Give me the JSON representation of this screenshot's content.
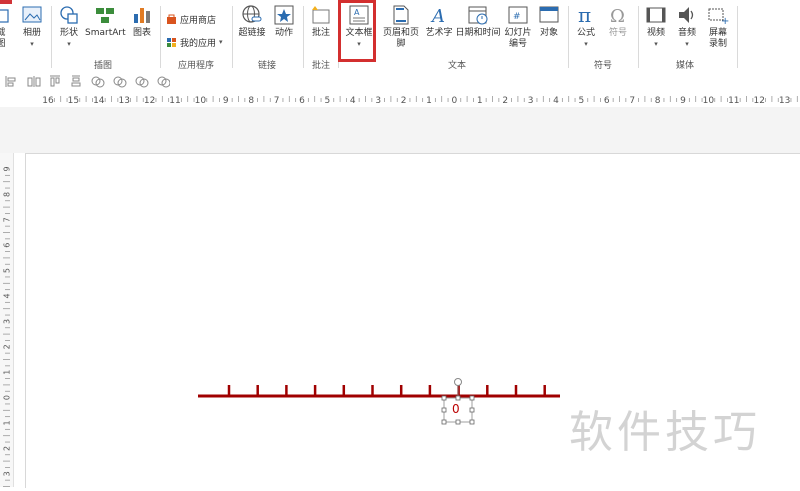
{
  "ribbon": {
    "partial_left_label": "截图",
    "buttons": {
      "album": "相册",
      "shapes": "形状",
      "smartart": "SmartArt",
      "chart": "图表",
      "app_store": "应用商店",
      "my_apps": "我的应用",
      "hyperlink": "超链接",
      "action": "动作",
      "comment": "批注",
      "textbox": "文本框",
      "header_footer": "页眉和页脚",
      "wordart": "艺术字",
      "date_time": "日期和时间",
      "slide_number_line1": "幻灯片",
      "slide_number_line2": "编号",
      "object": "对象",
      "equation": "公式",
      "symbol": "符号",
      "video": "视频",
      "audio": "音频",
      "screen_rec_line1": "屏幕",
      "screen_rec_line2": "录制"
    },
    "groups": {
      "illustrations": "插图",
      "apps": "应用程序",
      "links": "链接",
      "comments": "批注",
      "text": "文本",
      "symbols": "符号",
      "media": "媒体"
    }
  },
  "ruler": {
    "horizontal_labels": [
      "16",
      "15",
      "14",
      "13",
      "12",
      "11",
      "10",
      "9",
      "8",
      "7",
      "6",
      "5",
      "4",
      "3",
      "2",
      "1",
      "0",
      "1",
      "2",
      "3",
      "4",
      "5",
      "6",
      "7",
      "8",
      "9",
      "10",
      "11",
      "12",
      "13",
      "14"
    ],
    "vertical_labels": [
      "9",
      "8",
      "7",
      "6",
      "5",
      "4",
      "3",
      "2",
      "1",
      "0",
      "1",
      "2",
      "3"
    ]
  },
  "slide": {
    "textbox_value": "0",
    "watermark": "软件技巧"
  },
  "colors": {
    "highlight": "#d32f2f",
    "number_line": "#a00000",
    "accent_blue": "#2b6cb0"
  },
  "icons": [
    "album-icon",
    "shapes-icon",
    "smartart-icon",
    "chart-icon",
    "store-icon",
    "my-apps-icon",
    "hyperlink-icon",
    "action-icon",
    "comment-icon",
    "textbox-icon",
    "header-footer-icon",
    "wordart-icon",
    "date-time-icon",
    "slide-number-icon",
    "object-icon",
    "pi-icon",
    "omega-icon",
    "video-icon",
    "audio-icon",
    "screen-record-icon"
  ]
}
